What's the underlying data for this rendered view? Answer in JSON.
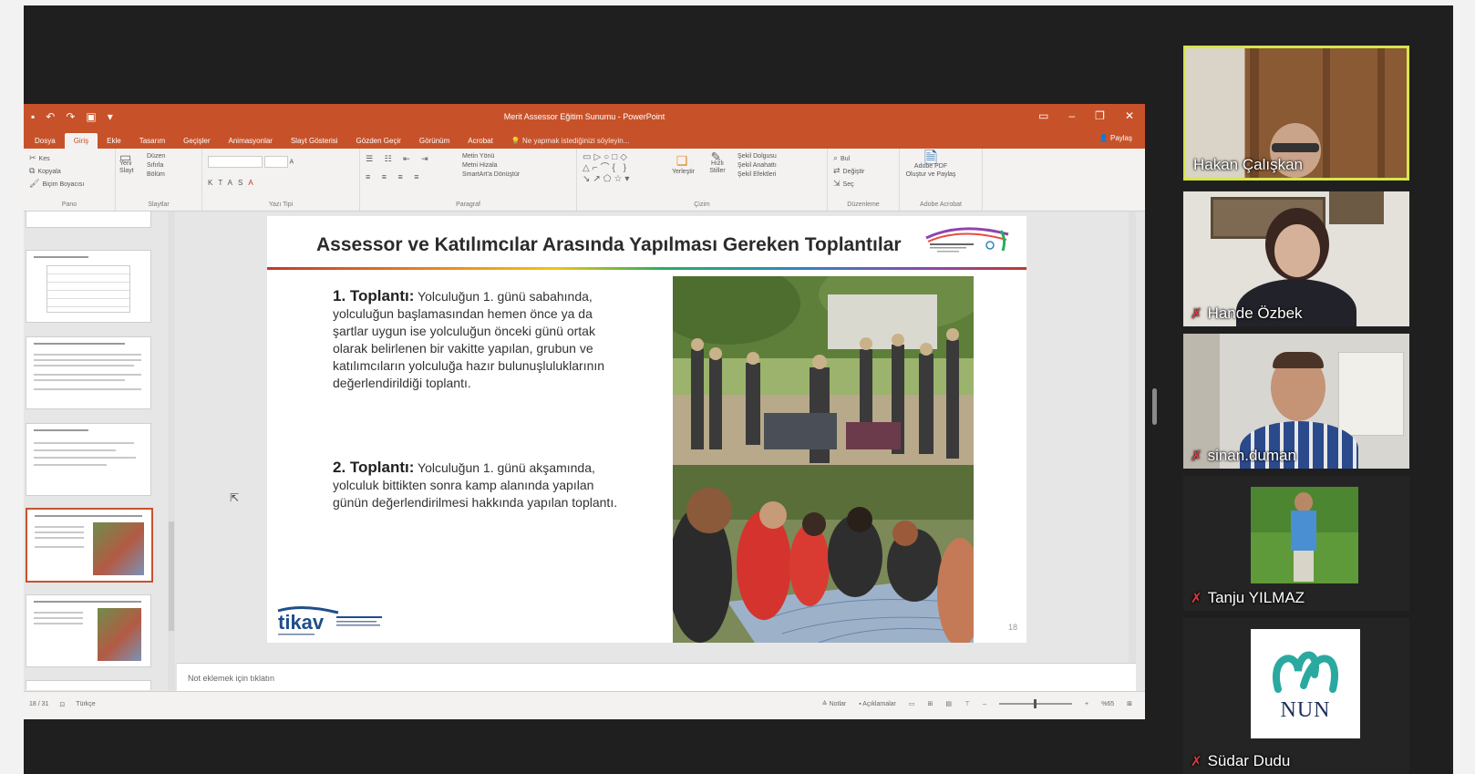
{
  "ppt": {
    "doc_title": "Merit Assessor Eğitim Sunumu - PowerPoint",
    "tabs": [
      "Dosya",
      "Giriş",
      "Ekle",
      "Tasarım",
      "Geçişler",
      "Animasyonlar",
      "Slayt Gösterisi",
      "Gözden Geçir",
      "Görünüm",
      "Acrobat"
    ],
    "active_tab": "Giriş",
    "tell_me": "Ne yapmak istediğinizi söyleyin...",
    "share": "Paylaş",
    "ribbon": {
      "clipboard": {
        "cut": "Kes",
        "copy": "Kopyala",
        "format_painter": "Biçim Boyacısı",
        "name": "Pano"
      },
      "slides": {
        "new_slide": "Yeni Slayt",
        "layout": "Düzen",
        "reset": "Sıfırla",
        "section": "Bölüm",
        "name": "Slaytlar"
      },
      "font": {
        "name": "Yazı Tipi"
      },
      "paragraph": {
        "text_direction": "Metin Yönü",
        "align_text": "Metni Hizala",
        "smartart": "SmartArt'a Dönüştür",
        "name": "Paragraf"
      },
      "drawing": {
        "arrange": "Yerleştir",
        "quick_styles": "Hızlı Stiller",
        "shape_fill": "Şekil Dolgusu",
        "shape_outline": "Şekil Anahattı",
        "shape_effects": "Şekil Efektleri",
        "name": "Çizim"
      },
      "editing": {
        "find": "Bul",
        "replace": "Değiştir",
        "select": "Seç",
        "name": "Düzenleme"
      },
      "acrobat": {
        "create_pdf": "Adobe PDF Oluştur ve Paylaş",
        "name": "Adobe Acrobat"
      }
    },
    "notes_placeholder": "Not eklemek için tıklatın",
    "status": {
      "slide_count": "18 / 31",
      "language": "Türkçe",
      "notes": "Notlar",
      "comments": "Açıklamalar",
      "zoom": "%65"
    }
  },
  "slide": {
    "title": "Assessor ve Katılımcılar Arasında Yapılması Gereken Toplantılar",
    "meeting1_head": "1. Toplantı:",
    "meeting1_body": " Yolculuğun 1. günü sabahında, yolculuğun başlamasından hemen önce ya da şartlar uygun ise yolculuğun önceki günü ortak olarak belirlenen bir vakitte yapılan, grubun ve katılımcıların yolculuğa hazır bulunuşluluklarının değerlendirildiği toplantı.",
    "meeting2_head": "2. Toplantı:",
    "meeting2_body": " Yolculuğun 1. günü akşamında, yolculuk bittikten sonra kamp alanında yapılan günün değerlendirilmesi hakkında yapılan toplantı.",
    "logo_text": "tikav",
    "slide_number": "18"
  },
  "participants": [
    {
      "name": "Hakan Çalışkan",
      "muted": false,
      "speaking": true
    },
    {
      "name": "Hande Özbek",
      "muted": true,
      "speaking": false
    },
    {
      "name": "sinan.duman",
      "muted": true,
      "speaking": false
    },
    {
      "name": "Tanju YILMAZ",
      "muted": true,
      "speaking": false
    },
    {
      "name": "Südar Dudu",
      "muted": true,
      "speaking": false,
      "avatar_logo": "NUN"
    }
  ],
  "colors": {
    "ppt_accent": "#c7522a",
    "speaking_border": "#d6e64c",
    "muted_mic": "#e0393e",
    "meeting_bg": "#1f1f1f"
  },
  "icons": {
    "mic_muted": "mic-muted-icon",
    "cursor": "cursor-icon"
  }
}
